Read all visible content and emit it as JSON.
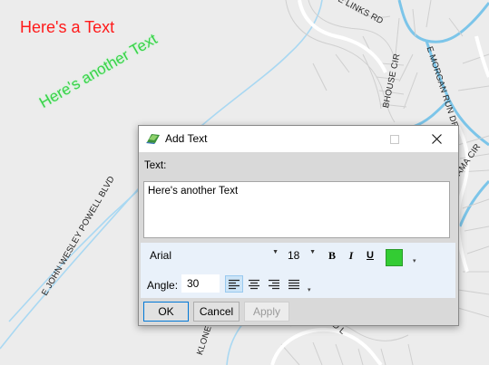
{
  "map": {
    "overlay_texts": [
      {
        "text": "Here's a Text",
        "color": "#ff1a1a"
      },
      {
        "text": "Here's another Text",
        "color": "#3ad14a"
      }
    ],
    "road_labels": [
      "E LINKS RD",
      "E MORGAN RUN DR",
      "BHOUSE CIR",
      "AMA CIR",
      "E JOHN WESLEY POWELL BLVD",
      "KLONE",
      "ED L"
    ]
  },
  "dialog": {
    "title": "Add Text",
    "text_label": "Text:",
    "text_value": "Here's another Text",
    "font": {
      "family": "Arial",
      "size": "18"
    },
    "format": {
      "bold_label": "B",
      "italic_label": "I",
      "underline_label": "U"
    },
    "color": "#33cc33",
    "angle_label": "Angle:",
    "angle_value": "30",
    "alignment_selected": "left",
    "buttons": {
      "ok": "OK",
      "cancel": "Cancel",
      "apply": "Apply"
    }
  }
}
